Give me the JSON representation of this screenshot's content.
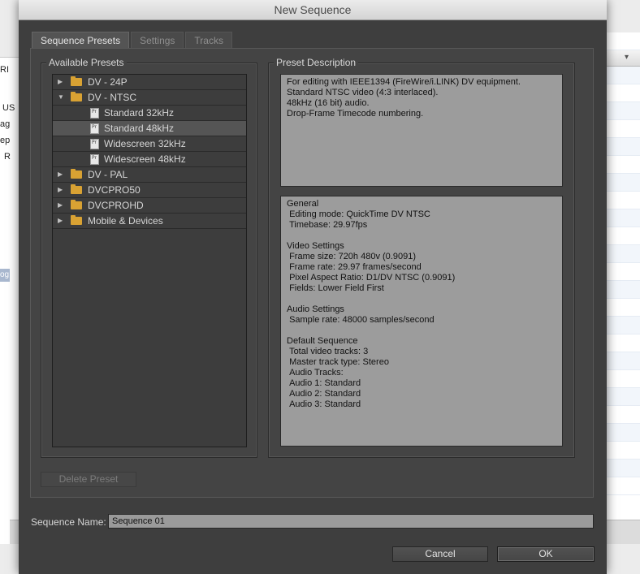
{
  "background_app": {
    "left_fragments": [
      "RI",
      "US",
      "ag",
      "ep",
      "R",
      "og"
    ]
  },
  "dialog": {
    "title": "New Sequence",
    "tabs": [
      {
        "label": "Sequence Presets",
        "active": true
      },
      {
        "label": "Settings",
        "active": false
      },
      {
        "label": "Tracks",
        "active": false
      }
    ],
    "available_presets": {
      "title": "Available Presets",
      "items": [
        {
          "label": "DV - 24P",
          "type": "folder",
          "expanded": false
        },
        {
          "label": "DV - NTSC",
          "type": "folder",
          "expanded": true
        },
        {
          "label": "Standard 32kHz",
          "type": "preset",
          "selected": false
        },
        {
          "label": "Standard 48kHz",
          "type": "preset",
          "selected": true
        },
        {
          "label": "Widescreen 32kHz",
          "type": "preset",
          "selected": false
        },
        {
          "label": "Widescreen 48kHz",
          "type": "preset",
          "selected": false
        },
        {
          "label": "DV - PAL",
          "type": "folder",
          "expanded": false
        },
        {
          "label": "DVCPRO50",
          "type": "folder",
          "expanded": false
        },
        {
          "label": "DVCPROHD",
          "type": "folder",
          "expanded": false
        },
        {
          "label": "Mobile & Devices",
          "type": "folder",
          "expanded": false
        }
      ],
      "preset_icon_text": "Pr"
    },
    "preset_description": {
      "title": "Preset Description",
      "summary": "For editing with IEEE1394 (FireWire/i.LINK) DV equipment.\nStandard NTSC video (4:3 interlaced).\n48kHz (16 bit) audio.\nDrop-Frame Timecode numbering.",
      "details": "General\n Editing mode: QuickTime DV NTSC\n Timebase: 29.97fps\n\nVideo Settings\n Frame size: 720h 480v (0.9091)\n Frame rate: 29.97 frames/second\n Pixel Aspect Ratio: D1/DV NTSC (0.9091)\n Fields: Lower Field First\n\nAudio Settings\n Sample rate: 48000 samples/second\n\nDefault Sequence\n Total video tracks: 3\n Master track type: Stereo\n Audio Tracks:\n Audio 1: Standard\n Audio 2: Standard\n Audio 3: Standard"
    },
    "delete_preset_label": "Delete Preset",
    "sequence_name": {
      "label": "Sequence Name:",
      "value": "Sequence 01"
    },
    "cancel_label": "Cancel",
    "ok_label": "OK"
  }
}
